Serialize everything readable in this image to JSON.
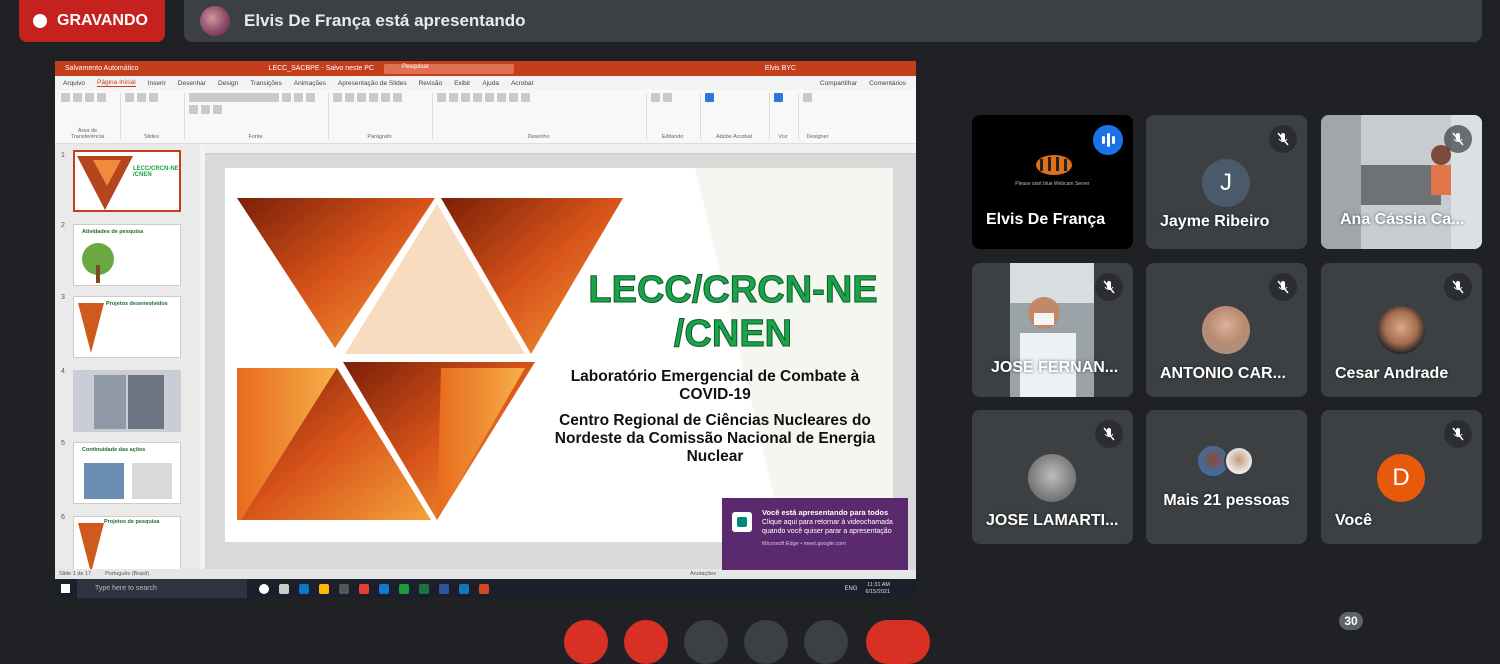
{
  "recording": {
    "label": "GRAVANDO",
    "color": "#c5221f"
  },
  "presenter_banner": {
    "text": "Elvis De França está apresentando"
  },
  "shared_screen": {
    "ppt": {
      "autosave": "Salvamento Automático",
      "filename": "LECC_SACBPE - Salvo neste PC",
      "search": "Pesquisar",
      "user": "Elvis BYC",
      "tabs": [
        "Arquivo",
        "Página Inicial",
        "Inserir",
        "Desenhar",
        "Design",
        "Transições",
        "Animações",
        "Apresentação de Slides",
        "Revisão",
        "Exibir",
        "Ajuda",
        "Acrobat"
      ],
      "share": "Compartilhar",
      "comments": "Comentários",
      "ribbon_groups": [
        "Área de Transferência",
        "Slides",
        "Fonte",
        "Parágrafo",
        "Desenho",
        "Editando",
        "Adobe Acrobat",
        "Voz",
        "Designer"
      ],
      "slide_title": "LECC/CRCN-NE /CNEN",
      "slide_sub1": "Laboratório Emergencial de Combate à COVID-19",
      "slide_sub2": "Centro Regional de Ciências Nucleares do Nordeste da Comissão Nacional de Energia Nuclear",
      "thumbs": [
        {
          "num": "1",
          "title": "LECC/CRCN-NE /CNEN"
        },
        {
          "num": "2",
          "title": "Atividades de pesquisa"
        },
        {
          "num": "3",
          "title": "Projetos desenvolvidos"
        },
        {
          "num": "4",
          "title": ""
        },
        {
          "num": "5",
          "title": "Continuidade das ações"
        },
        {
          "num": "6",
          "title": "Projetos de pesquisa"
        }
      ],
      "status_slide": "Slide 1 de 17",
      "status_lang": "Português (Brasil)",
      "status_notes": "Anotações",
      "status_zoom": "Comentários"
    },
    "taskbar": {
      "search": "Type here to search",
      "lang": "ENG",
      "time": "11:31 AM",
      "date": "6/15/2021"
    },
    "toast": {
      "title": "Você está apresentando para todos",
      "body": "Clique aqui para retornar à videochamada quando você quiser parar a apresentação",
      "source": "Microsoft Edge • meet.google.com"
    }
  },
  "participants": [
    {
      "name": "Elvis De França",
      "muted": false,
      "speaking": true,
      "caption": "Please start blue Webcam Server"
    },
    {
      "name": "Jayme Ribeiro",
      "muted": true,
      "initial": "J"
    },
    {
      "name": "Ana Cássia Ca...",
      "muted": true
    },
    {
      "name": "JOSE FERNAN...",
      "muted": true
    },
    {
      "name": "ANTONIO CAR...",
      "muted": true
    },
    {
      "name": "Cesar Andrade",
      "muted": true
    },
    {
      "name": "JOSE LAMARTI...",
      "muted": true
    },
    {
      "name": "Mais 21 pessoas",
      "muted": false
    },
    {
      "name": "Você",
      "muted": true,
      "initial": "D",
      "initial_color": "#e8590c"
    }
  ],
  "participant_count_badge": "30"
}
